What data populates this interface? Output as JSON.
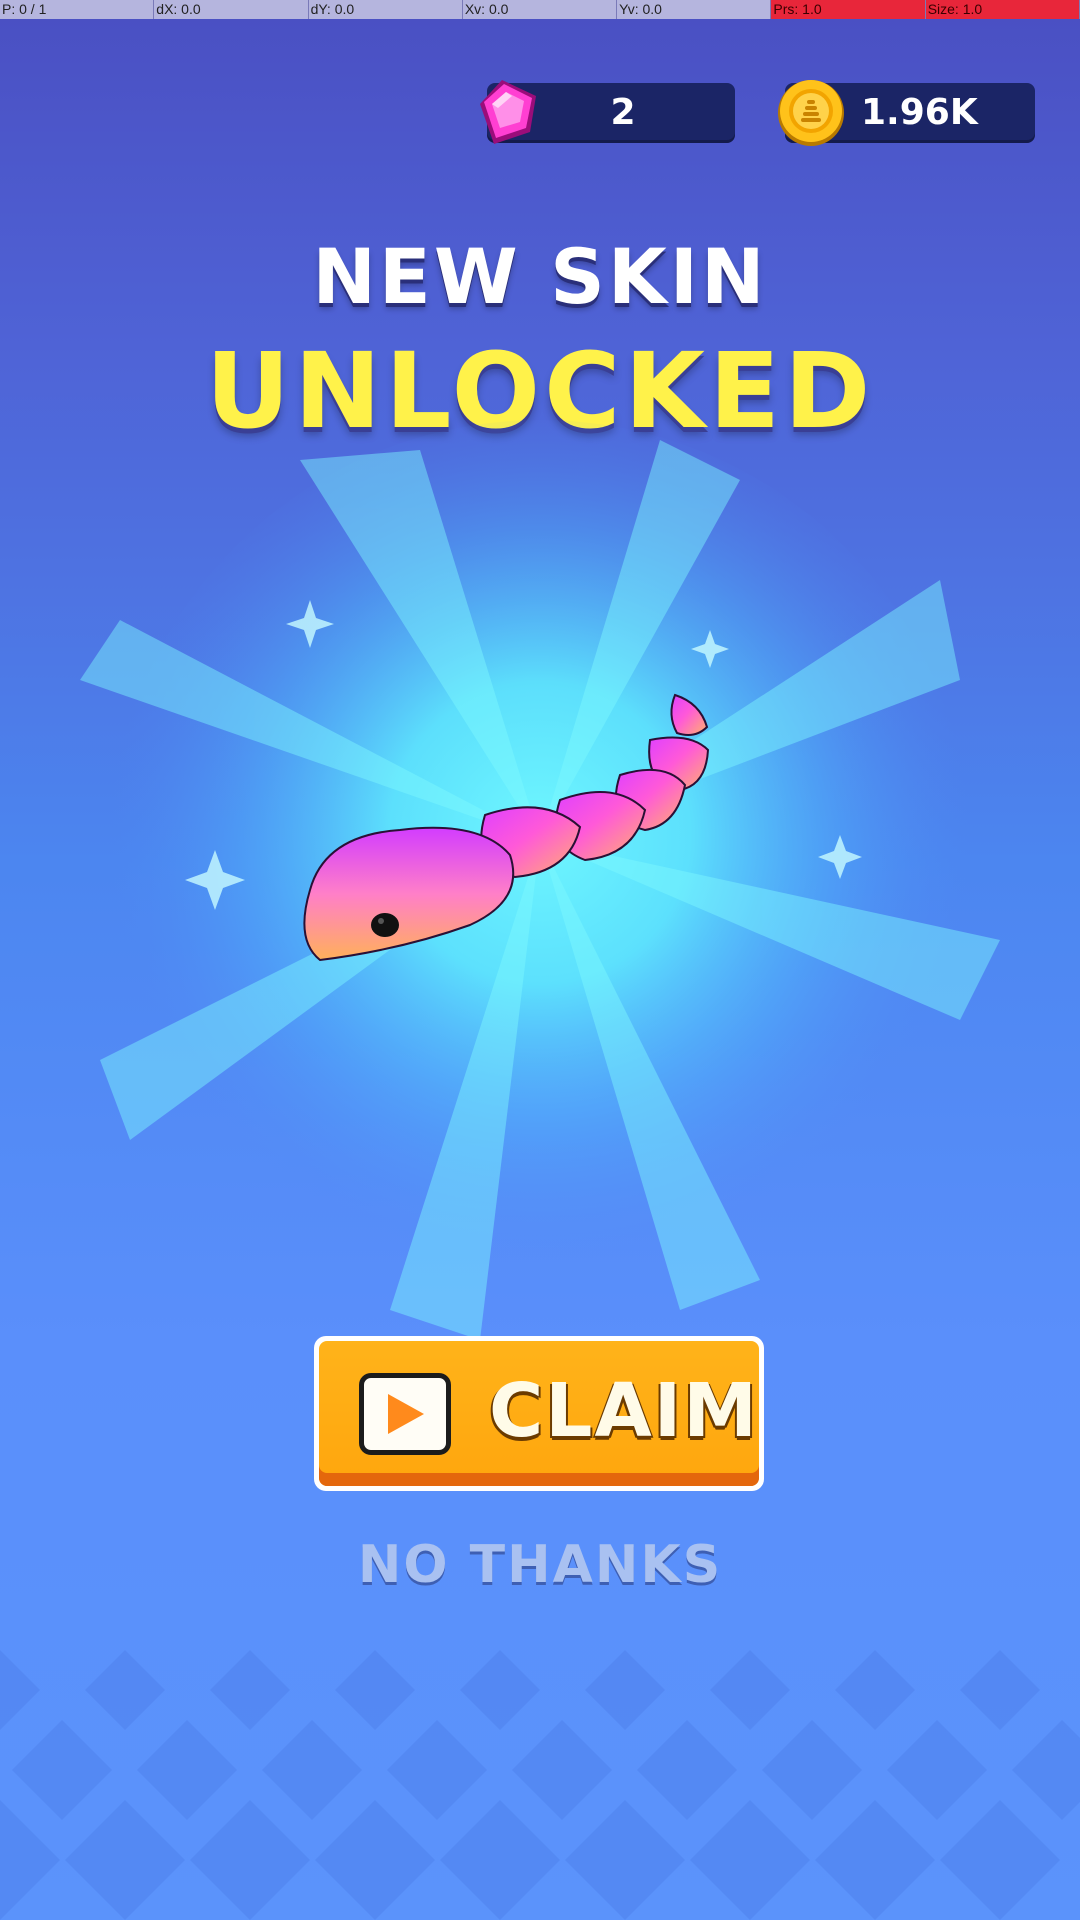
{
  "debug_overlay": {
    "cells": [
      "P: 0 / 1",
      "dX: 0.0",
      "dY: 0.0",
      "Xv: 0.0",
      "Yv: 0.0",
      "Prs: 1.0",
      "Size: 1.0"
    ]
  },
  "currency": {
    "gems": {
      "value": "2",
      "icon": "gem-icon"
    },
    "coins": {
      "value": "1.96K",
      "icon": "coin-icon"
    }
  },
  "reward": {
    "title_line1": "NEW SKIN",
    "title_line2": "UNLOCKED",
    "skin_preview": "snake-skin-rainbow"
  },
  "actions": {
    "claim_label": "CLAIM",
    "claim_icon": "play-video-icon",
    "decline_label": "NO THANKS"
  },
  "colors": {
    "title_yellow": "#fff24a",
    "claim_orange": "#ffa60d",
    "pill_navy": "#1b2566"
  }
}
